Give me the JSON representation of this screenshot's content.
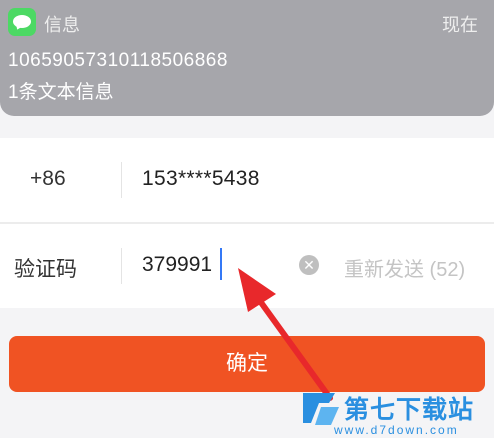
{
  "notification": {
    "app_icon": "messages-icon",
    "app_name": "信息",
    "time": "现在",
    "sender": "10659057310118506868",
    "body": "1条文本信息"
  },
  "form": {
    "country_code": "+86",
    "phone": "153****5438",
    "code_label": "验证码",
    "code_value": "379991",
    "clear_icon": "clear-circle-icon",
    "clear_glyph": "✕",
    "resend": "重新发送 (52)"
  },
  "confirm_label": "确定",
  "watermark": {
    "title": "第七下载站",
    "url": "www.d7down.com"
  },
  "colors": {
    "accent": "#f05323",
    "annotation_arrow": "#e8282b",
    "notification_bg": "#a6a6ab",
    "app_icon_green": "#4cd964",
    "watermark_blue": "#2a8fe0"
  }
}
